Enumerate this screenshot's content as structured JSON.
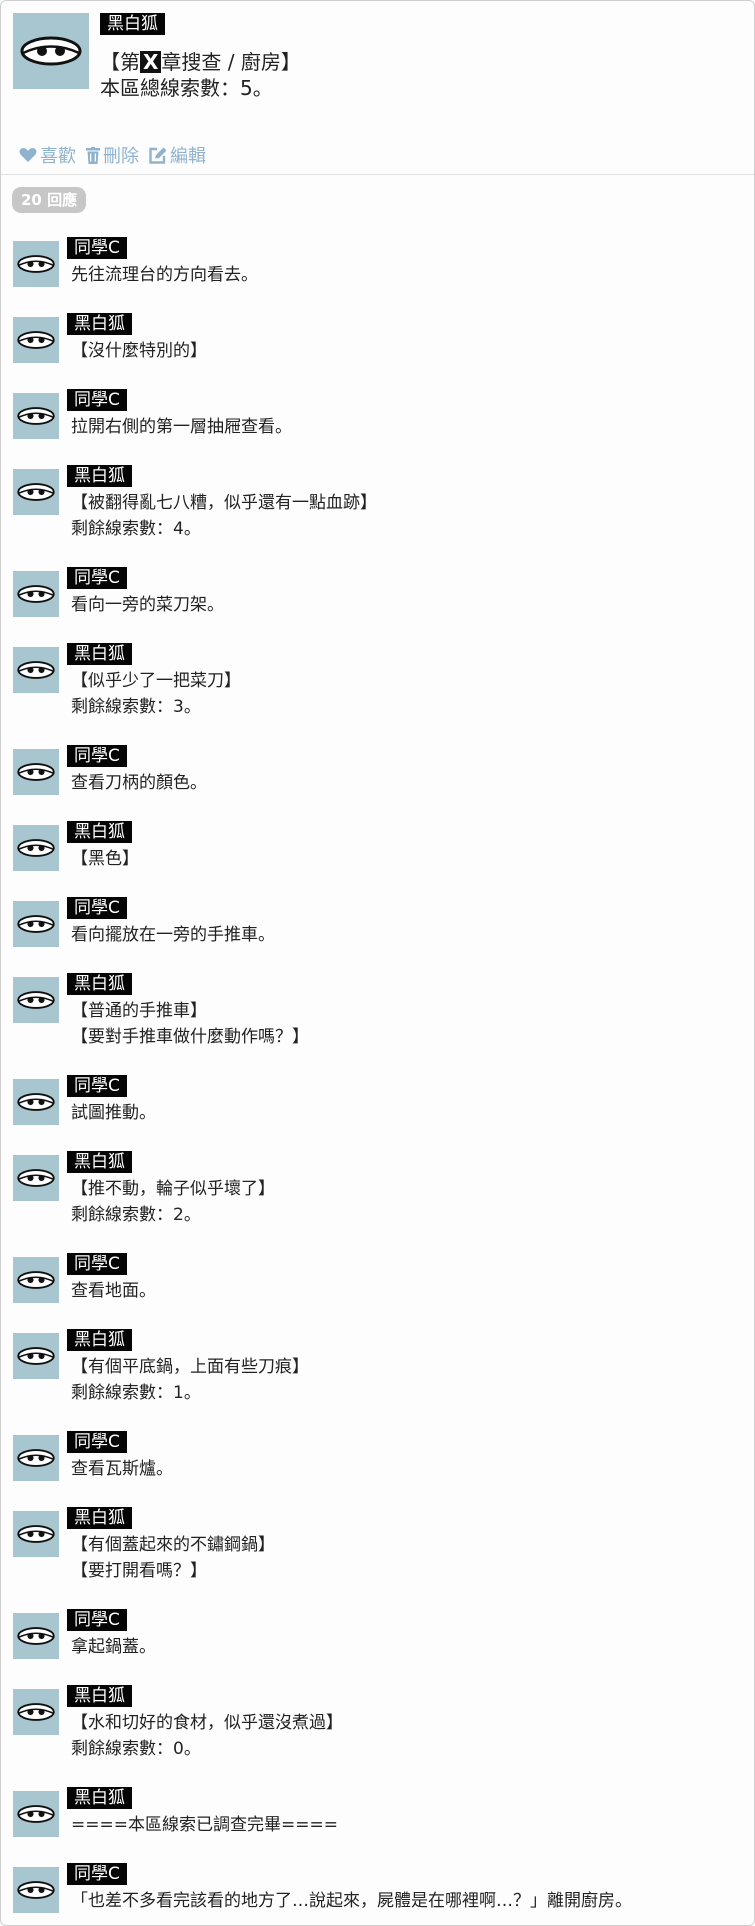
{
  "post": {
    "author": "黑白狐",
    "title_prefix": "【第",
    "title_box": "X",
    "title_suffix": "章搜查 / 廚房】",
    "body_line2": "本區總線索數：5。",
    "actions": {
      "like": "喜歡",
      "delete": "刪除",
      "edit": "編輯"
    },
    "accent_color": "#8fb3cf"
  },
  "reply_count_label": "20 回應",
  "replies": [
    {
      "author": "同學C",
      "lines": [
        "先往流理台的方向看去。"
      ]
    },
    {
      "author": "黑白狐",
      "lines": [
        "【沒什麼特別的】"
      ]
    },
    {
      "author": "同學C",
      "lines": [
        "拉開右側的第一層抽屜查看。"
      ]
    },
    {
      "author": "黑白狐",
      "lines": [
        "【被翻得亂七八糟，似乎還有一點血跡】",
        "剩餘線索數：4。"
      ]
    },
    {
      "author": "同學C",
      "lines": [
        "看向一旁的菜刀架。"
      ]
    },
    {
      "author": "黑白狐",
      "lines": [
        "【似乎少了一把菜刀】",
        "剩餘線索數：3。"
      ]
    },
    {
      "author": "同學C",
      "lines": [
        "查看刀柄的顏色。"
      ]
    },
    {
      "author": "黑白狐",
      "lines": [
        "【黑色】"
      ]
    },
    {
      "author": "同學C",
      "lines": [
        "看向擺放在一旁的手推車。"
      ]
    },
    {
      "author": "黑白狐",
      "lines": [
        "【普通的手推車】",
        "【要對手推車做什麼動作嗎？】"
      ]
    },
    {
      "author": "同學C",
      "lines": [
        "試圖推動。"
      ]
    },
    {
      "author": "黑白狐",
      "lines": [
        "【推不動，輪子似乎壞了】",
        "剩餘線索數：2。"
      ]
    },
    {
      "author": "同學C",
      "lines": [
        "查看地面。"
      ]
    },
    {
      "author": "黑白狐",
      "lines": [
        "【有個平底鍋，上面有些刀痕】",
        "剩餘線索數：1。"
      ]
    },
    {
      "author": "同學C",
      "lines": [
        "查看瓦斯爐。"
      ]
    },
    {
      "author": "黑白狐",
      "lines": [
        "【有個蓋起來的不鏽鋼鍋】",
        "【要打開看嗎？】"
      ]
    },
    {
      "author": "同學C",
      "lines": [
        "拿起鍋蓋。"
      ]
    },
    {
      "author": "黑白狐",
      "lines": [
        "【水和切好的食材，似乎還沒煮過】",
        "剩餘線索數：0。"
      ]
    },
    {
      "author": "黑白狐",
      "lines": [
        "====本區線索已調查完畢===="
      ]
    },
    {
      "author": "同學C",
      "lines": [
        "「也差不多看完該看的地方了…說起來，屍體是在哪裡啊…？」離開廚房。"
      ]
    }
  ]
}
